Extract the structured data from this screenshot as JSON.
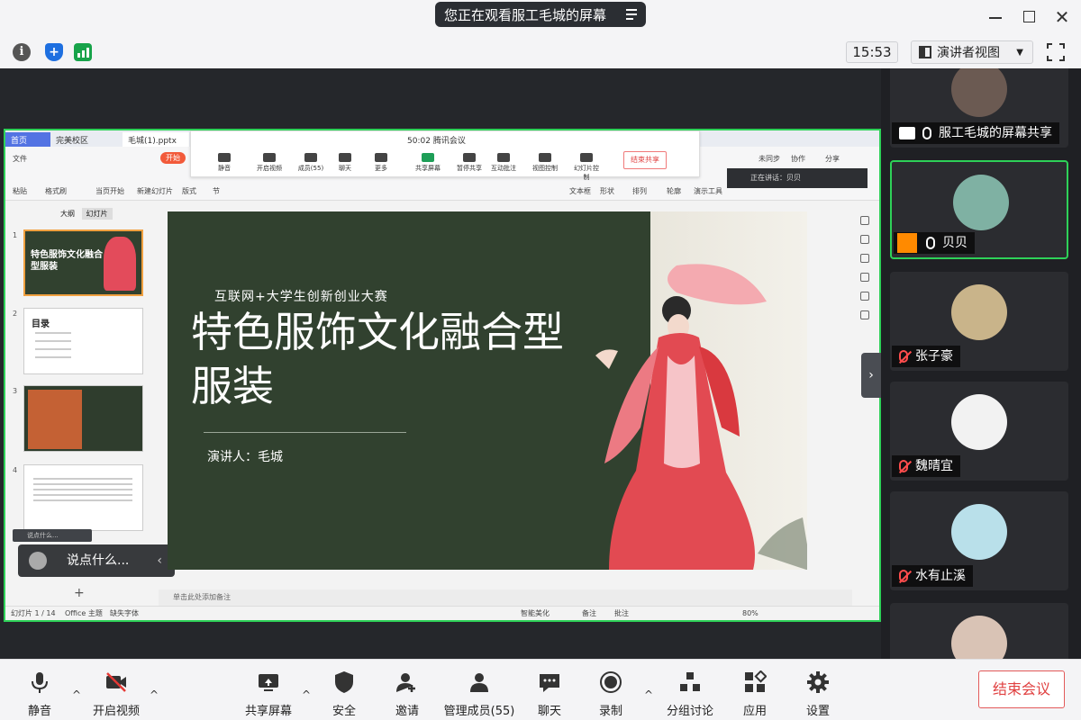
{
  "titlebar": {
    "share_text": "您正在观看服工毛城的屏幕"
  },
  "toolbar": {
    "time": "15:53",
    "view_mode": "演讲者视图"
  },
  "wps": {
    "tabs": [
      "首页",
      "完美校区",
      "毛城(1).pptx"
    ],
    "start_label": "开始",
    "ribbon_items": [
      "文件",
      "粘贴",
      "格式刷",
      "当页开始",
      "新建幻灯片",
      "版式",
      "节",
      "文本框",
      "形状",
      "排列",
      "轮廓",
      "演示工具",
      "未同步",
      "协作",
      "分享"
    ],
    "meeting_bar": {
      "time": "50:02",
      "title": "腾讯会议",
      "items": [
        "静音",
        "开启视频",
        "成员(55)",
        "聊天",
        "更多",
        "共享屏幕",
        "暂停共享",
        "互动批注",
        "视图控制",
        "幻灯片控制"
      ],
      "end_label": "结束共享"
    },
    "speaking": "正在讲话：贝贝",
    "panel_tabs": [
      "大纲",
      "幻灯片"
    ],
    "thumbs": [
      {
        "num": "1",
        "title": "特色服饰文化融合型服装"
      },
      {
        "num": "2",
        "title": "目录"
      },
      {
        "num": "3",
        "title": ""
      },
      {
        "num": "4",
        "title": ""
      }
    ],
    "chat_chip": "说点什么...",
    "chat_bubble": "说点什么...",
    "notes_hint": "单击此处添加备注",
    "status_left": [
      "幻灯片 1 / 14",
      "Office 主题",
      "缺失字体"
    ],
    "status_right": [
      "智能美化",
      "备注",
      "批注",
      "80%"
    ]
  },
  "slide": {
    "subtitle": "互联网+大学生创新创业大赛",
    "title": "特色服饰文化融合型服装",
    "speaker": "演讲人：毛城"
  },
  "participants": [
    {
      "name": "服工毛城的屏幕共享",
      "mic": "on",
      "badge": "screen",
      "avatar_color": "#6b5a52"
    },
    {
      "name": "贝贝",
      "mic": "on",
      "badge": "user",
      "avatar_color": "#7fb1a3",
      "active": true
    },
    {
      "name": "张子豪",
      "mic": "muted",
      "badge": "",
      "avatar_color": "#c9b48a"
    },
    {
      "name": "魏晴宜",
      "mic": "muted",
      "badge": "",
      "avatar_color": "#f2f2f2"
    },
    {
      "name": "水有止溪",
      "mic": "muted",
      "badge": "",
      "avatar_color": "#b9e0ea"
    },
    {
      "name": "",
      "mic": "",
      "badge": "",
      "avatar_color": "#d9c3b5"
    }
  ],
  "bottombar": {
    "mute": "静音",
    "video": "开启视频",
    "share": "共享屏幕",
    "security": "安全",
    "invite": "邀请",
    "members": "管理成员(55)",
    "chat": "聊天",
    "record": "录制",
    "breakout": "分组讨论",
    "apps": "应用",
    "settings": "设置",
    "end": "结束会议"
  },
  "colors": {
    "share_border": "#2ed158",
    "slide_bg": "#31412f",
    "end_red": "#e04040"
  }
}
